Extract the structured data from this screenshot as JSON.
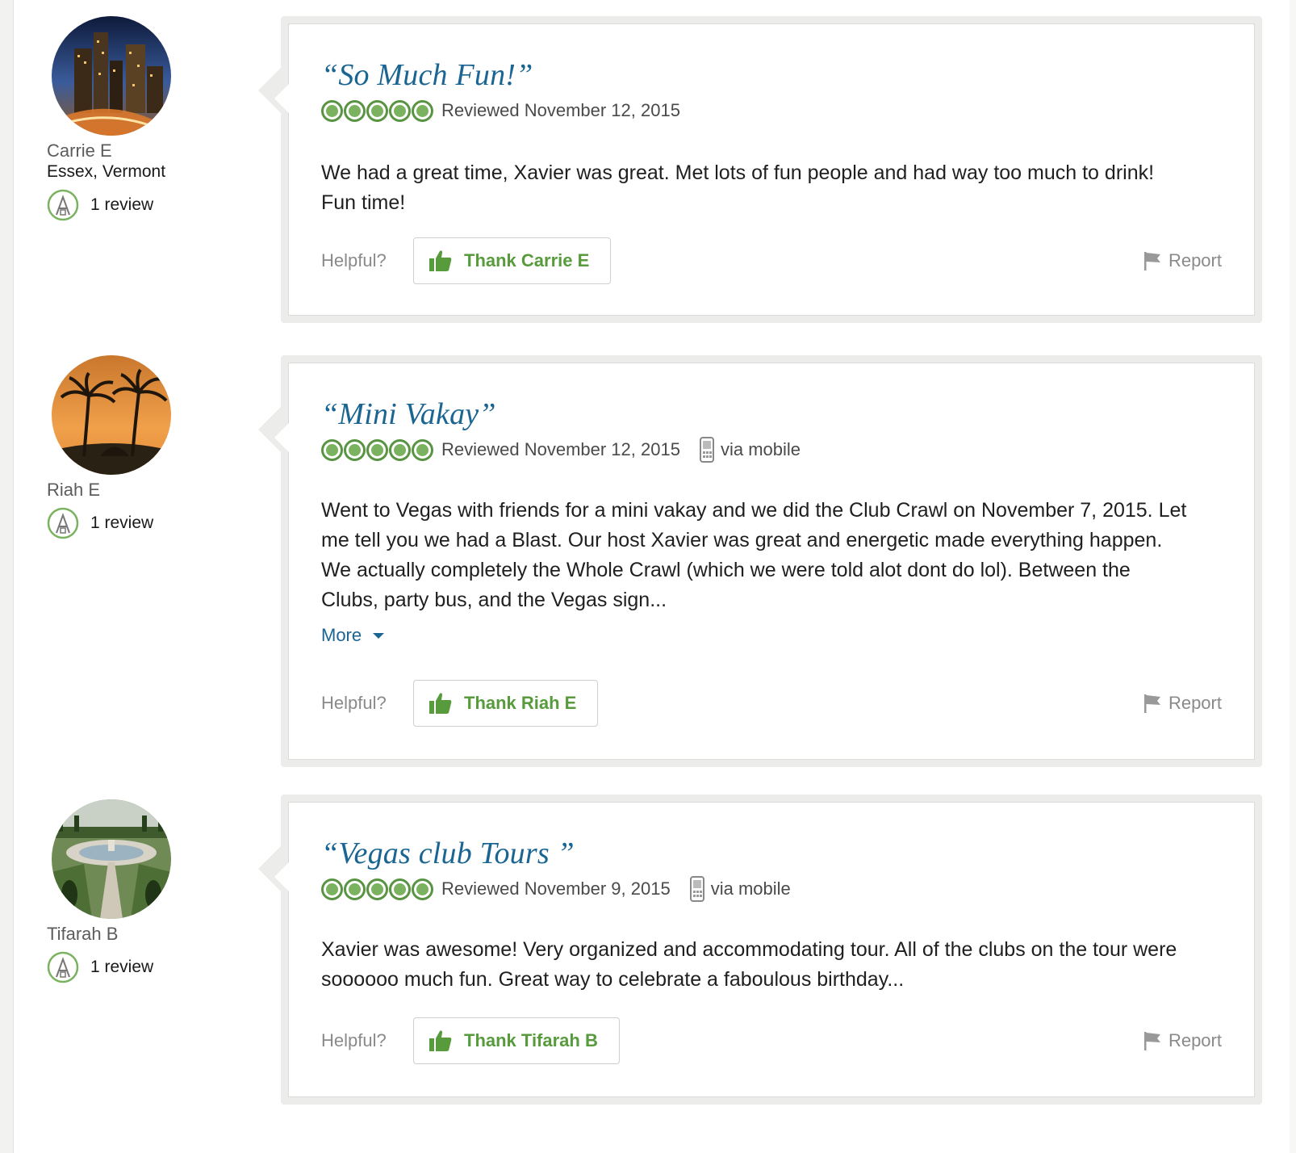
{
  "colors": {
    "title_blue": "#1b6593",
    "bubble_green": "#589442",
    "thank_green": "#579b3c",
    "muted_gray": "#8a8a8a"
  },
  "labels": {
    "helpful": "Helpful?",
    "report": "Report",
    "via_mobile": "via mobile",
    "more": "More"
  },
  "reviews": [
    {
      "member": {
        "name": "Carrie E",
        "location": "Essex, Vermont",
        "review_count": "1 review",
        "avatar": "city-skyline-night"
      },
      "title": "“So Much Fun!”",
      "rating": 5,
      "reviewed": "Reviewed November 12, 2015",
      "mobile": false,
      "body": "We had a great time, Xavier was great. Met lots of fun people and had way too much to drink! Fun time!",
      "more": false,
      "thank_label": "Thank Carrie E"
    },
    {
      "member": {
        "name": "Riah E",
        "location": "",
        "review_count": "1 review",
        "avatar": "palm-trees-sunset"
      },
      "title": "“Mini Vakay”",
      "rating": 5,
      "reviewed": "Reviewed November 12, 2015",
      "mobile": true,
      "body": "Went to Vegas with friends for a mini vakay and we did the Club Crawl on November 7, 2015. Let me tell you we had a Blast. Our host Xavier was great and energetic made everything happen. We actually completely the Whole Crawl (which we were told alot dont do lol). Between the Clubs, party bus, and the Vegas sign...",
      "more": true,
      "thank_label": "Thank Riah E"
    },
    {
      "member": {
        "name": "Tifarah B",
        "location": "",
        "review_count": "1 review",
        "avatar": "garden-fountain"
      },
      "title": "“Vegas club Tours ”",
      "rating": 5,
      "reviewed": "Reviewed November 9, 2015",
      "mobile": true,
      "body": "Xavier was awesome! Very organized and accommodating tour. All of the clubs on the tour were soooooo much fun. Great way to celebrate a faboulous birthday...",
      "more": false,
      "thank_label": "Thank Tifarah B"
    }
  ]
}
